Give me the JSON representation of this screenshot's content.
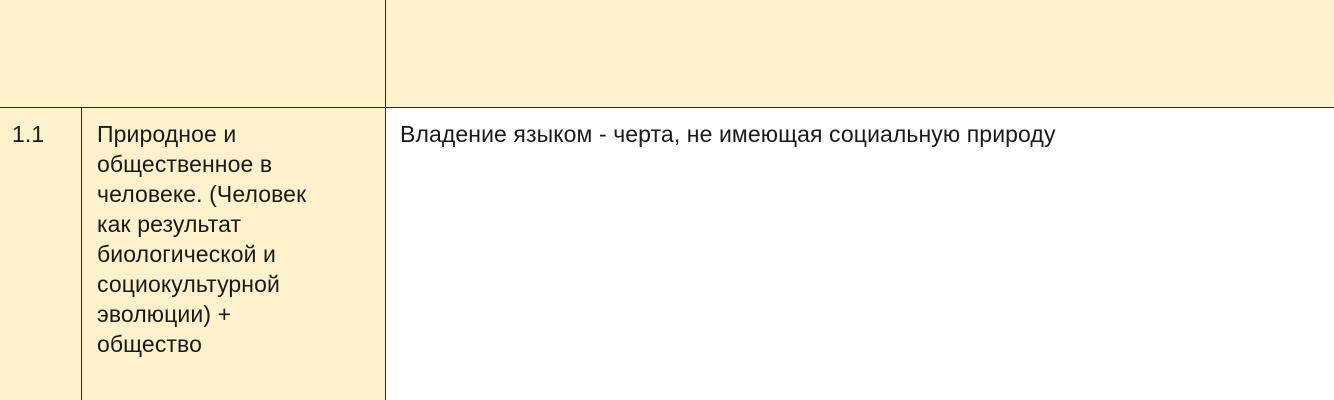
{
  "colors": {
    "accent_background": "#fff1cc",
    "cell_background": "#ffffff",
    "border": "#2b2b2b",
    "text": "#1a1a1a"
  },
  "table": {
    "header_row": {
      "left": "",
      "right": ""
    },
    "rows": [
      {
        "number": "1.1",
        "topic": "Природное и\nобщественное в\nчеловеке. (Человек\nкак результат\nбиологической и\nсоциокультурной\nэволюции) +\nобщество",
        "statement": "Владение языком - черта, не имеющая социальную природу"
      }
    ]
  }
}
